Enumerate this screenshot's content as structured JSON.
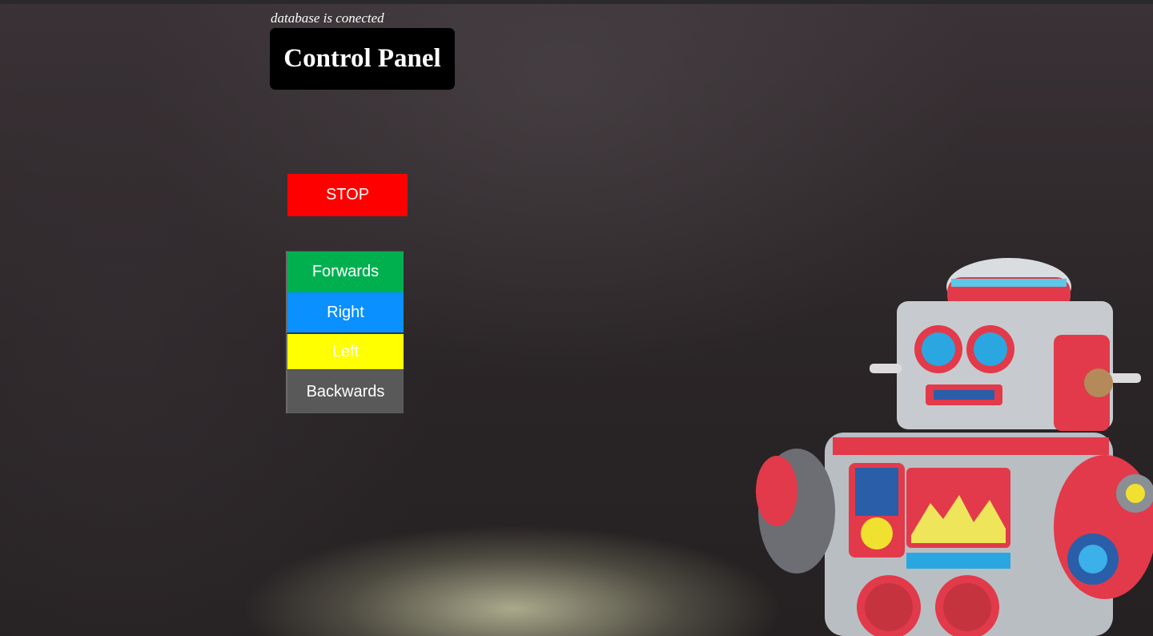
{
  "status_text": "database is conected",
  "title": "Control Panel",
  "stop_label": "STOP",
  "controls": {
    "forwards": "Forwards",
    "right": "Right",
    "left": "Left",
    "backwards": "Backwards"
  },
  "colors": {
    "stop": "#ff0000",
    "forwards": "#00b04f",
    "right": "#0a90ff",
    "left": "#ffff00",
    "backwards": "#595959",
    "title_bg": "#000000"
  },
  "background_image": "toy-robot-photo"
}
